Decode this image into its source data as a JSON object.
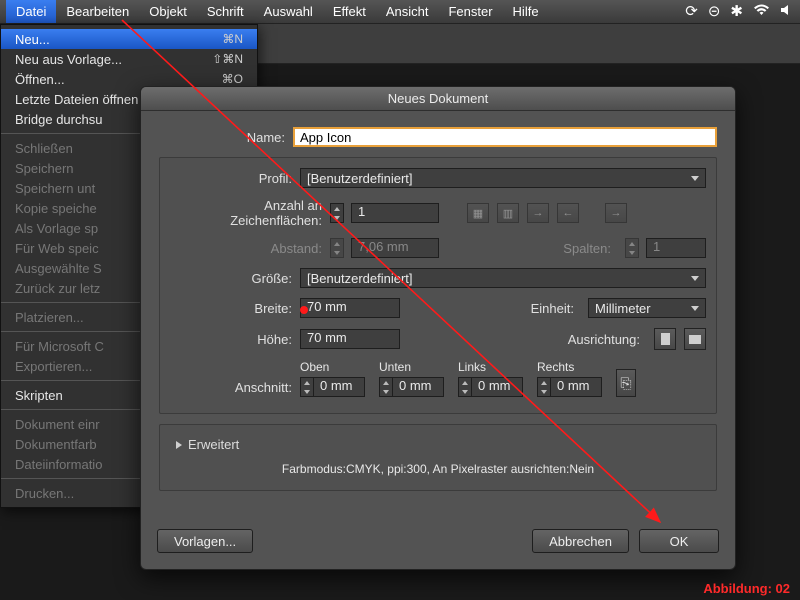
{
  "menubar": {
    "items": [
      "Datei",
      "Bearbeiten",
      "Objekt",
      "Schrift",
      "Auswahl",
      "Effekt",
      "Ansicht",
      "Fenster",
      "Hilfe"
    ],
    "active_index": 0
  },
  "dropdown": {
    "items": [
      {
        "label": "Neu...",
        "shortcut": "⌘N",
        "highlight": true
      },
      {
        "label": "Neu aus Vorlage...",
        "shortcut": "⇧⌘N"
      },
      {
        "label": "Öffnen...",
        "shortcut": "⌘O"
      },
      {
        "label": "Letzte Dateien öffnen",
        "submenu": true
      },
      {
        "label": "Bridge durchsu"
      },
      {
        "sep": true
      },
      {
        "label": "Schließen",
        "disabled": true
      },
      {
        "label": "Speichern",
        "disabled": true
      },
      {
        "label": "Speichern unt",
        "disabled": true
      },
      {
        "label": "Kopie speiche",
        "disabled": true
      },
      {
        "label": "Als Vorlage sp",
        "disabled": true
      },
      {
        "label": "Für Web speic",
        "disabled": true
      },
      {
        "label": "Ausgewählte S",
        "disabled": true
      },
      {
        "label": "Zurück zur letz",
        "disabled": true
      },
      {
        "sep": true
      },
      {
        "label": "Platzieren...",
        "disabled": true
      },
      {
        "sep": true
      },
      {
        "label": "Für Microsoft C",
        "disabled": true
      },
      {
        "label": "Exportieren...",
        "disabled": true
      },
      {
        "sep": true
      },
      {
        "label": "Skripten"
      },
      {
        "sep": true
      },
      {
        "label": "Dokument einr",
        "disabled": true
      },
      {
        "label": "Dokumentfarb",
        "disabled": true
      },
      {
        "label": "Dateiinformatio",
        "disabled": true
      },
      {
        "sep": true
      },
      {
        "label": "Drucken...",
        "disabled": true
      }
    ]
  },
  "dialog": {
    "title": "Neues Dokument",
    "name_label": "Name:",
    "name_value": "App Icon",
    "profile_label": "Profil:",
    "profile_value": "[Benutzerdefiniert]",
    "artboards_label": "Anzahl an Zeichenflächen:",
    "artboards_value": "1",
    "spacing_label": "Abstand:",
    "spacing_value": "7,06 mm",
    "columns_label": "Spalten:",
    "columns_value": "1",
    "size_label": "Größe:",
    "size_value": "[Benutzerdefiniert]",
    "width_label": "Breite:",
    "width_value": "70 mm",
    "unit_label": "Einheit:",
    "unit_value": "Millimeter",
    "height_label": "Höhe:",
    "height_value": "70 mm",
    "orient_label": "Ausrichtung:",
    "bleed_label": "Anschnitt:",
    "bleed": {
      "top": {
        "hdr": "Oben",
        "val": "0 mm"
      },
      "bottom": {
        "hdr": "Unten",
        "val": "0 mm"
      },
      "left": {
        "hdr": "Links",
        "val": "0 mm"
      },
      "right": {
        "hdr": "Rechts",
        "val": "0 mm"
      }
    },
    "advanced_label": "Erweitert",
    "summary": "Farbmodus:CMYK, ppi:300, An Pixelraster ausrichten:Nein",
    "templates_btn": "Vorlagen...",
    "cancel_btn": "Abbrechen",
    "ok_btn": "OK"
  },
  "caption": "Abbildung: 02"
}
